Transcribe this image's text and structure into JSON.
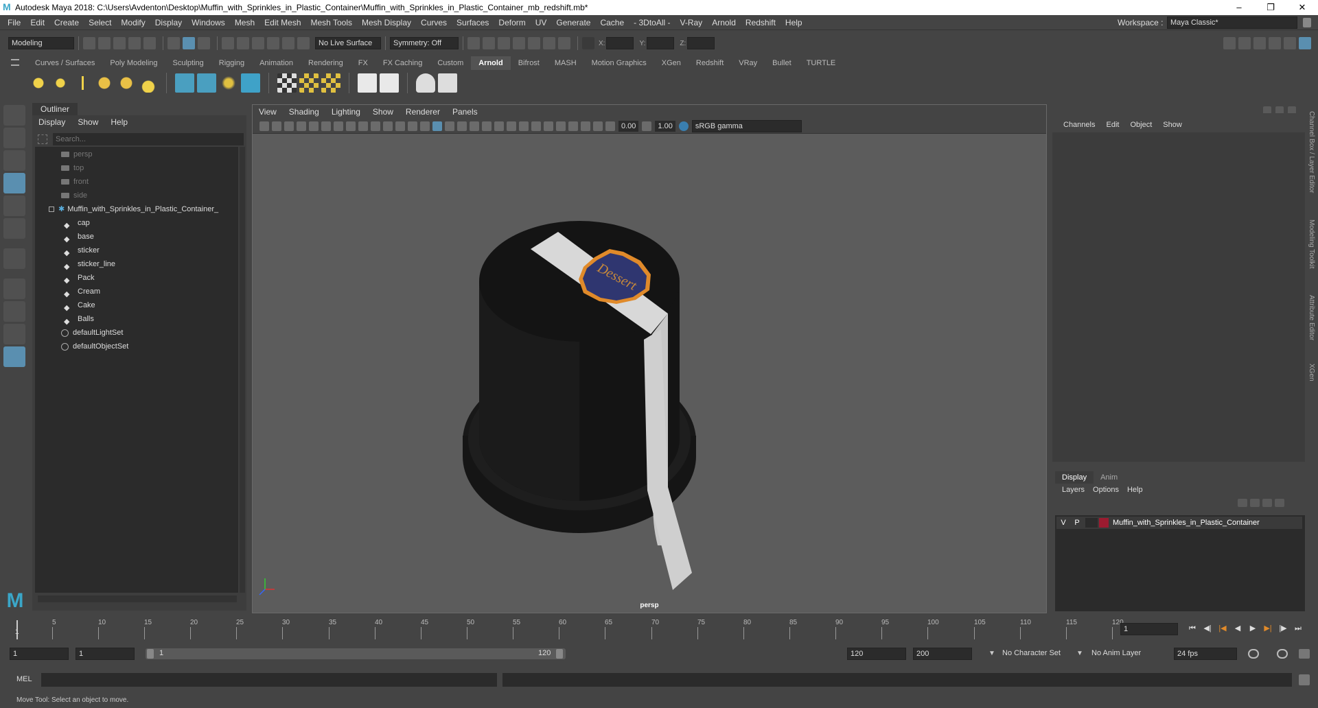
{
  "title": "Autodesk Maya 2018: C:\\Users\\Avdenton\\Desktop\\Muffin_with_Sprinkles_in_Plastic_Container\\Muffin_with_Sprinkles_in_Plastic_Container_mb_redshift.mb*",
  "menubar": [
    "File",
    "Edit",
    "Create",
    "Select",
    "Modify",
    "Display",
    "Windows",
    "Mesh",
    "Edit Mesh",
    "Mesh Tools",
    "Mesh Display",
    "Curves",
    "Surfaces",
    "Deform",
    "UV",
    "Generate",
    "Cache",
    "- 3DtoAll -",
    "V-Ray",
    "Arnold",
    "Redshift",
    "Help"
  ],
  "workspace": {
    "label": "Workspace :",
    "value": "Maya Classic*"
  },
  "status": {
    "mode": "Modeling",
    "live_surface": "No Live Surface",
    "symmetry": "Symmetry: Off",
    "x_label": "X:",
    "y_label": "Y:",
    "z_label": "Z:"
  },
  "shelf_tabs": [
    "Curves / Surfaces",
    "Poly Modeling",
    "Sculpting",
    "Rigging",
    "Animation",
    "Rendering",
    "FX",
    "FX Caching",
    "Custom",
    "Arnold",
    "Bifrost",
    "MASH",
    "Motion Graphics",
    "XGen",
    "Redshift",
    "VRay",
    "Bullet",
    "TURTLE"
  ],
  "shelf_active": "Arnold",
  "outliner": {
    "title": "Outliner",
    "menu": [
      "Display",
      "Show",
      "Help"
    ],
    "search_placeholder": "Search...",
    "cameras": [
      "persp",
      "top",
      "front",
      "side"
    ],
    "root": "Muffin_with_Sprinkles_in_Plastic_Container_",
    "children": [
      "cap",
      "base",
      "sticker",
      "sticker_line",
      "Pack",
      "Cream",
      "Cake",
      "Balls"
    ],
    "sets": [
      "defaultLightSet",
      "defaultObjectSet"
    ]
  },
  "viewport": {
    "menu": [
      "View",
      "Shading",
      "Lighting",
      "Show",
      "Renderer",
      "Panels"
    ],
    "exposure": "0.00",
    "gamma": "1.00",
    "colorspace": "sRGB gamma",
    "camera_label": "persp",
    "sticker_text": "Dessert"
  },
  "channel": {
    "menu": [
      "Channels",
      "Edit",
      "Object",
      "Show"
    ]
  },
  "layer": {
    "tabs": [
      "Display",
      "Anim"
    ],
    "menu": [
      "Layers",
      "Options",
      "Help"
    ],
    "row": {
      "v": "V",
      "p": "P",
      "name": "Muffin_with_Sprinkles_in_Plastic_Container",
      "color": "#9b1b30"
    }
  },
  "side_tabs": [
    "Channel Box / Layer Editor",
    "Modeling Toolkit",
    "Attribute Editor",
    "XGen"
  ],
  "timeline": {
    "ticks": [
      5,
      10,
      15,
      20,
      25,
      30,
      35,
      40,
      45,
      50,
      55,
      60,
      65,
      70,
      75,
      80,
      85,
      90,
      95,
      100,
      105,
      110,
      115,
      120
    ],
    "first": "1",
    "current": "1"
  },
  "range": {
    "start": "1",
    "start2": "1",
    "slider_start": "1",
    "slider_end": "120",
    "end": "120",
    "end2": "200",
    "character": "No Character Set",
    "anim_layer": "No Anim Layer",
    "fps": "24 fps"
  },
  "mel": {
    "label": "MEL"
  },
  "help_line": "Move Tool: Select an object to move."
}
